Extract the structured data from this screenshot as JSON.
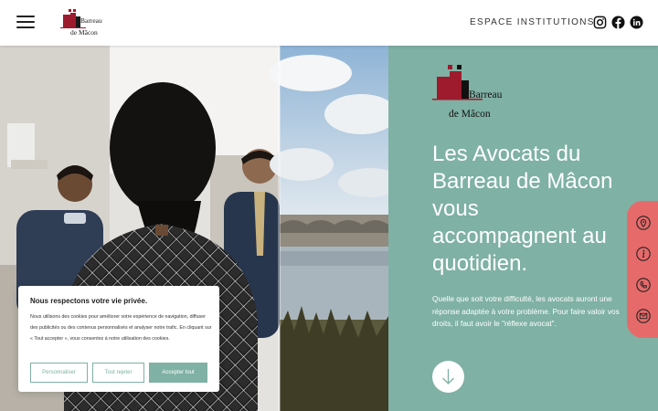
{
  "header": {
    "logo": {
      "line1": "Barreau",
      "line2": "de Mâcon"
    },
    "nav_link": "ESPACE INSTITUTIONS",
    "social_icons": [
      "instagram-icon",
      "facebook-icon",
      "linkedin-icon"
    ]
  },
  "hero": {
    "logo": {
      "line1": "Barreau",
      "line2": "de Mâcon"
    },
    "title": "Les Avocats du Barreau de Mâcon vous accompagnent au quotidien.",
    "text": "Quelle que soit votre difficulté, les avocats auront une réponse adaptée à votre problème. Pour faire valoir vos droits, il faut avoir le \"réflexe avocat\".",
    "scroll_icon": "arrow-down-icon"
  },
  "contact_rail": {
    "items": [
      "location-pin-icon",
      "info-icon",
      "phone-icon",
      "mail-icon"
    ]
  },
  "cookie": {
    "title": "Nous respectons votre vie privée.",
    "text": "Nous utilisons des cookies pour améliorer votre expérience de navigation, diffuser des publicités ou des contenus personnalisés et analyser notre trafic. En cliquant sur « Tout accepter », vous consentez à notre utilisation des cookies.",
    "customize_label": "Personnaliser",
    "reject_label": "Tout rejeter",
    "accept_label": "Accepter tout"
  },
  "colors": {
    "accent_green": "#7fb1a4",
    "accent_red": "#e66a6a",
    "logo_red": "#9e1b2d"
  }
}
